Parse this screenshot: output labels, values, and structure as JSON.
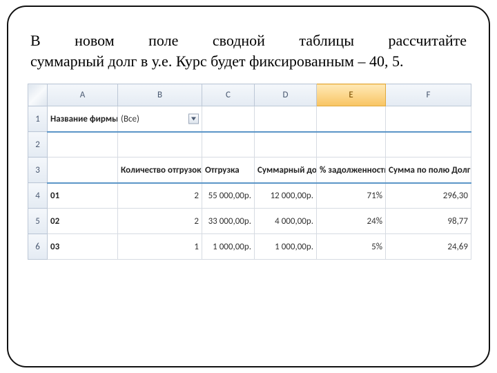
{
  "instruction": {
    "line1": "В новом поле сводной таблицы рассчитайте",
    "rest": "суммарный долг в у.е. Курс будет фиксированным – 40, 5."
  },
  "cols": {
    "A": "A",
    "B": "B",
    "C": "C",
    "D": "D",
    "E": "E",
    "F": "F"
  },
  "rows": {
    "r1": "1",
    "r2": "2",
    "r3": "3",
    "r4": "4",
    "r5": "5",
    "r6": "6"
  },
  "filter": {
    "label": "Название фирмы",
    "value": "(Все)"
  },
  "headers": {
    "b": "Количество отгрузок",
    "c": "Отгрузка",
    "d": "Суммарный долг",
    "e": "% задолженности",
    "f": "Сумма по полю Долг в у.е."
  },
  "data": [
    {
      "a": "01",
      "b": "2",
      "c": "55 000,00р.",
      "d": "12 000,00р.",
      "e": "71%",
      "f": "296,30"
    },
    {
      "a": "02",
      "b": "2",
      "c": "33 000,00р.",
      "d": "4 000,00р.",
      "e": "24%",
      "f": "98,77"
    },
    {
      "a": "03",
      "b": "1",
      "c": "1 000,00р.",
      "d": "1 000,00р.",
      "e": "5%",
      "f": "24,69"
    }
  ]
}
